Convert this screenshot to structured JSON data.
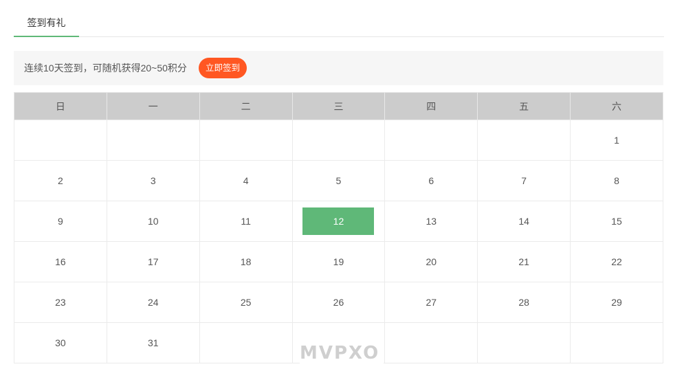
{
  "tabs": [
    {
      "label": "签到有礼",
      "active": true
    }
  ],
  "notice": {
    "text": "连续10天签到，可随机获得20~50积分",
    "button_label": "立即签到"
  },
  "calendar": {
    "weekdays": [
      "日",
      "一",
      "二",
      "三",
      "四",
      "五",
      "六"
    ],
    "weeks": [
      [
        "",
        "",
        "",
        "",
        "",
        "",
        "1"
      ],
      [
        "2",
        "3",
        "4",
        "5",
        "6",
        "7",
        "8"
      ],
      [
        "9",
        "10",
        "11",
        "12",
        "13",
        "14",
        "15"
      ],
      [
        "16",
        "17",
        "18",
        "19",
        "20",
        "21",
        "22"
      ],
      [
        "23",
        "24",
        "25",
        "26",
        "27",
        "28",
        "29"
      ],
      [
        "30",
        "31",
        "",
        "",
        "",
        "",
        ""
      ]
    ],
    "today": "12"
  },
  "watermark": "MVPXO",
  "colors": {
    "accent_green": "#5fb878",
    "button_orange": "#ff5722",
    "header_gray": "#cccccc"
  }
}
